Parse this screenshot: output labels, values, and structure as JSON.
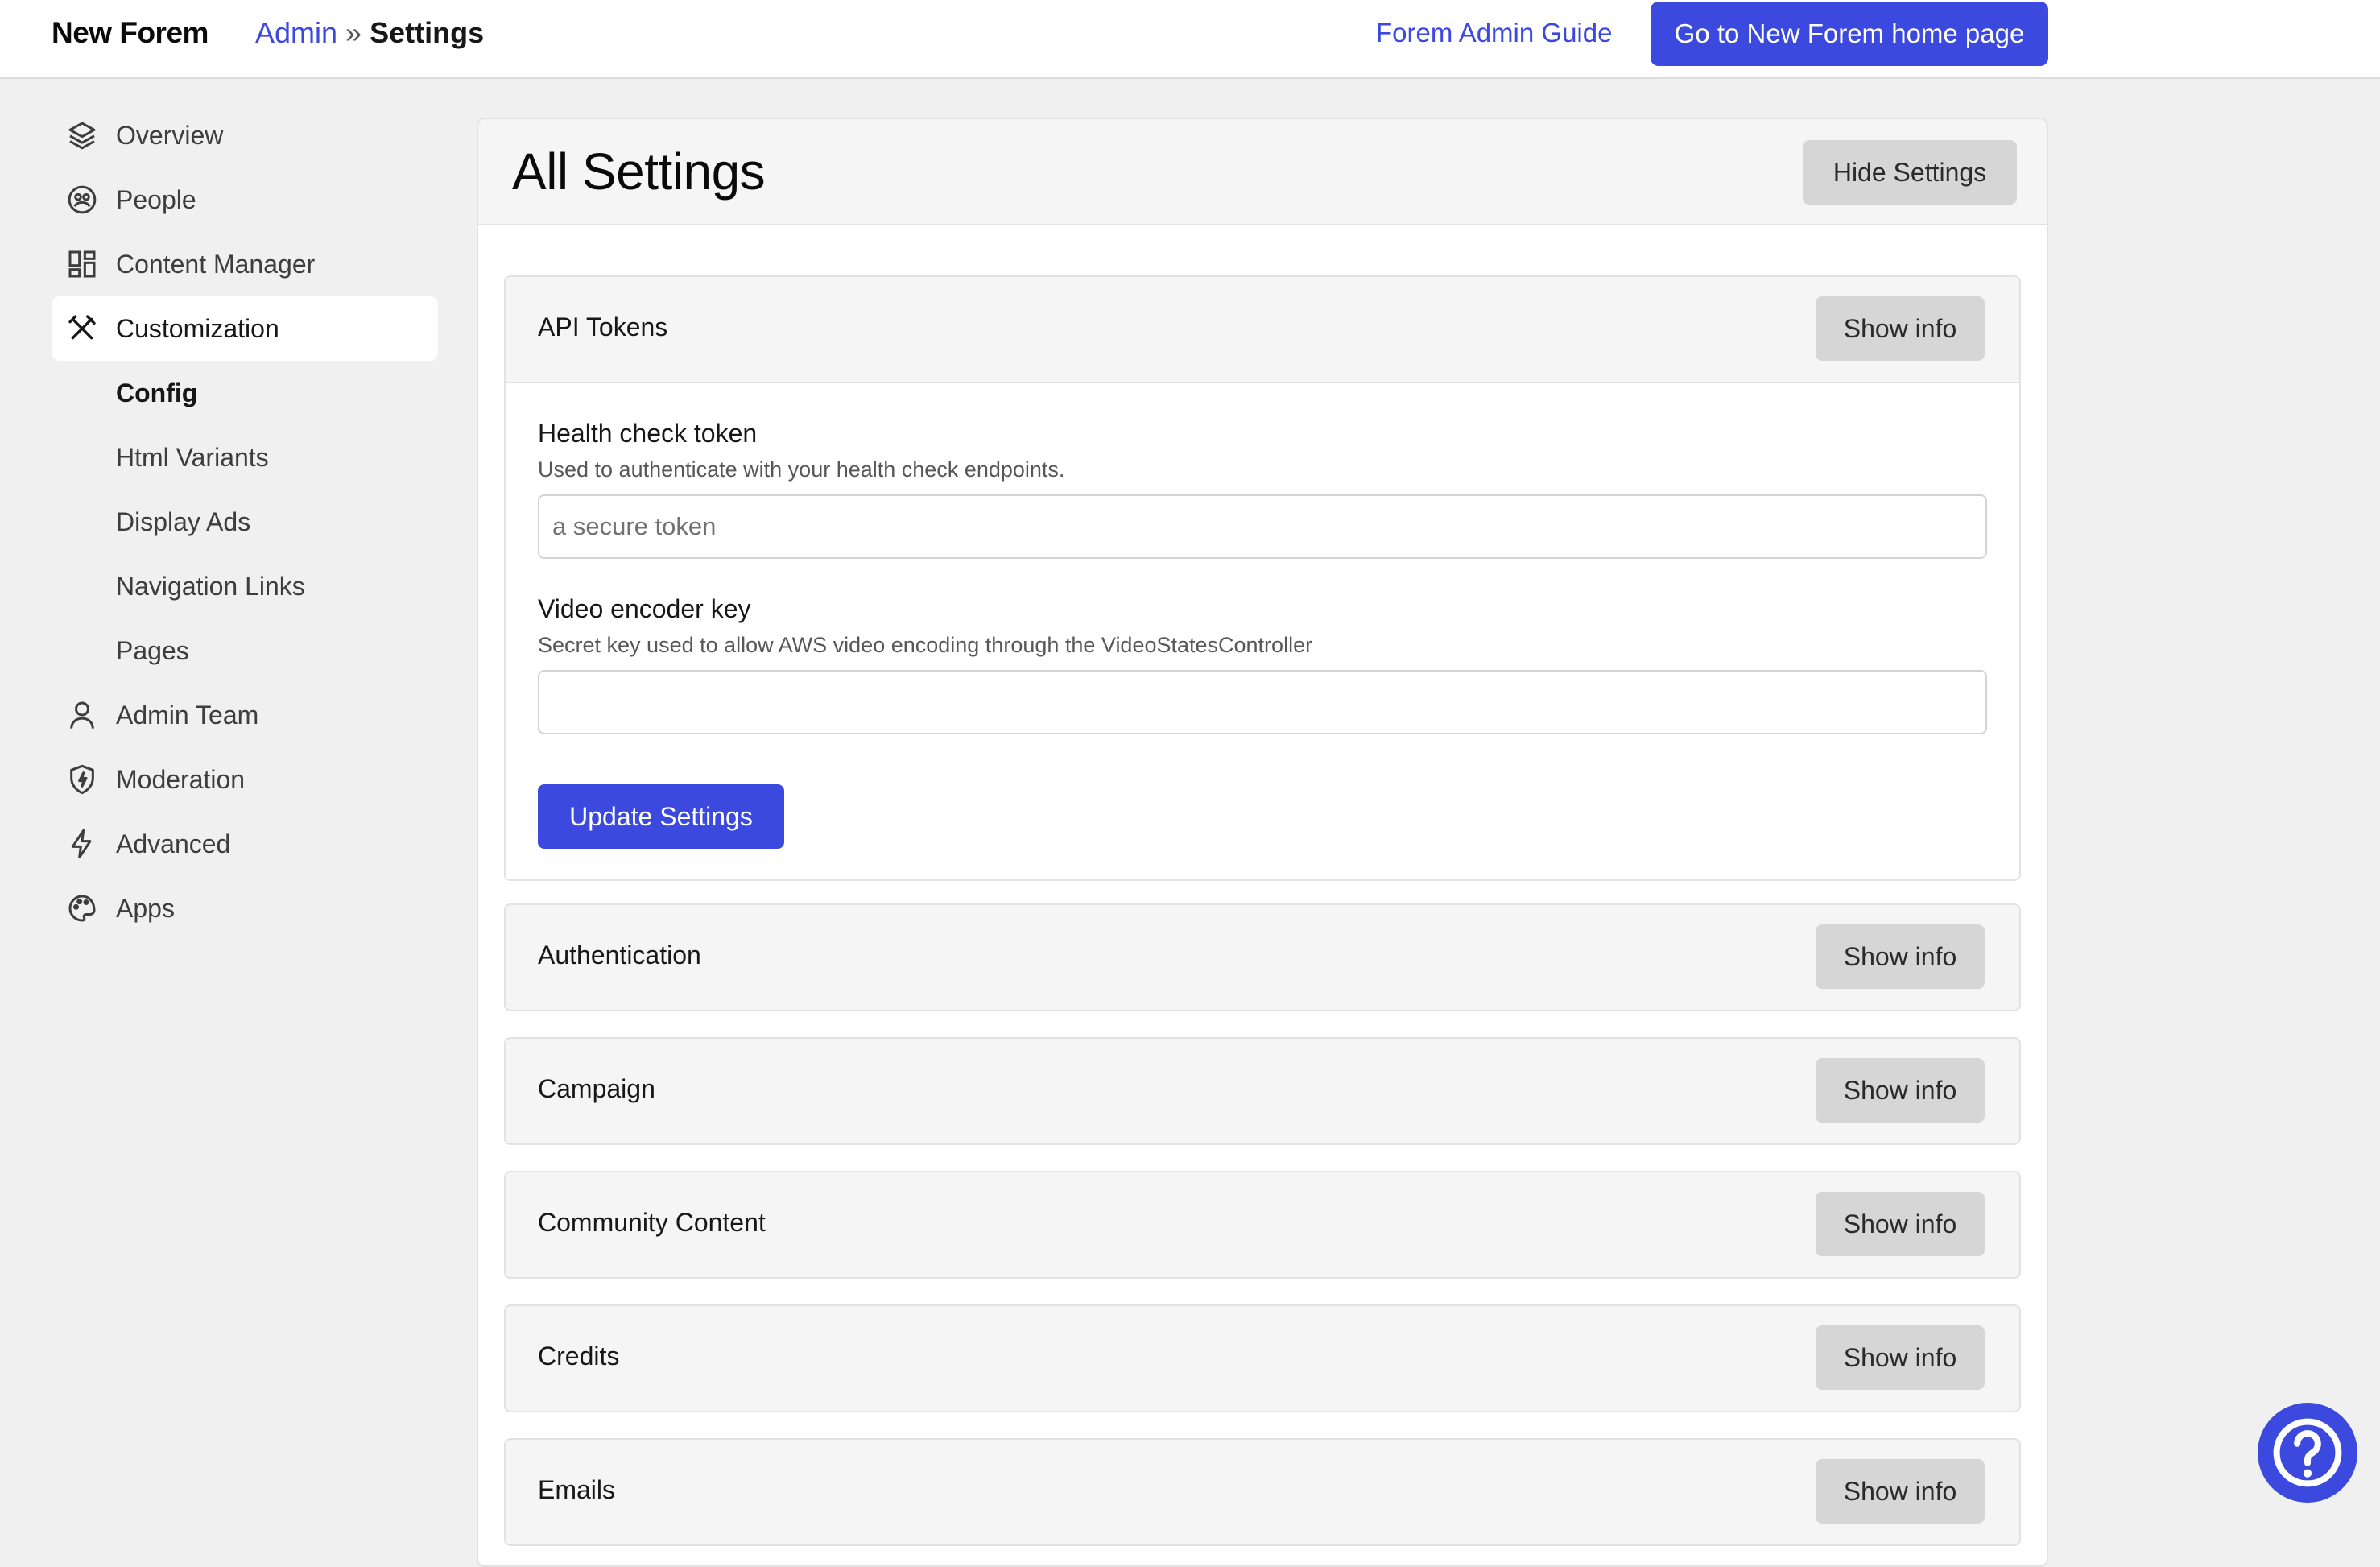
{
  "topbar": {
    "brand": "New Forem",
    "breadcrumb": {
      "root": "Admin",
      "separator": "»",
      "current": "Settings"
    },
    "guide_link": "Forem Admin Guide",
    "home_button": "Go to New Forem home page"
  },
  "sidebar": {
    "items": [
      {
        "label": "Overview",
        "icon": "layers-icon"
      },
      {
        "label": "People",
        "icon": "people-icon"
      },
      {
        "label": "Content Manager",
        "icon": "dashboard-icon"
      },
      {
        "label": "Customization",
        "icon": "tools-icon",
        "active": true
      },
      {
        "label": "Config",
        "sub": true,
        "bold": true
      },
      {
        "label": "Html Variants",
        "sub": true
      },
      {
        "label": "Display Ads",
        "sub": true
      },
      {
        "label": "Navigation Links",
        "sub": true
      },
      {
        "label": "Pages",
        "sub": true
      },
      {
        "label": "Admin Team",
        "icon": "user-icon"
      },
      {
        "label": "Moderation",
        "icon": "shield-icon"
      },
      {
        "label": "Advanced",
        "icon": "lightning-icon"
      },
      {
        "label": "Apps",
        "icon": "palette-icon"
      }
    ]
  },
  "main": {
    "title": "All Settings",
    "hide_button": "Hide Settings",
    "sections": [
      {
        "title": "API Tokens",
        "button": "Show info",
        "expanded": true
      },
      {
        "title": "Authentication",
        "button": "Show info"
      },
      {
        "title": "Campaign",
        "button": "Show info"
      },
      {
        "title": "Community Content",
        "button": "Show info"
      },
      {
        "title": "Credits",
        "button": "Show info"
      },
      {
        "title": "Emails",
        "button": "Show info"
      }
    ],
    "api_tokens": {
      "health_label": "Health check token",
      "health_help": "Used to authenticate with your health check endpoints.",
      "health_placeholder": "a secure token",
      "health_value": "",
      "video_label": "Video encoder key",
      "video_help": "Secret key used to allow AWS video encoding through the VideoStatesController",
      "video_value": "",
      "update_button": "Update Settings"
    }
  },
  "colors": {
    "accent": "#3b49df",
    "background": "#f0f0f0",
    "button_gray": "#d6d6d6"
  }
}
